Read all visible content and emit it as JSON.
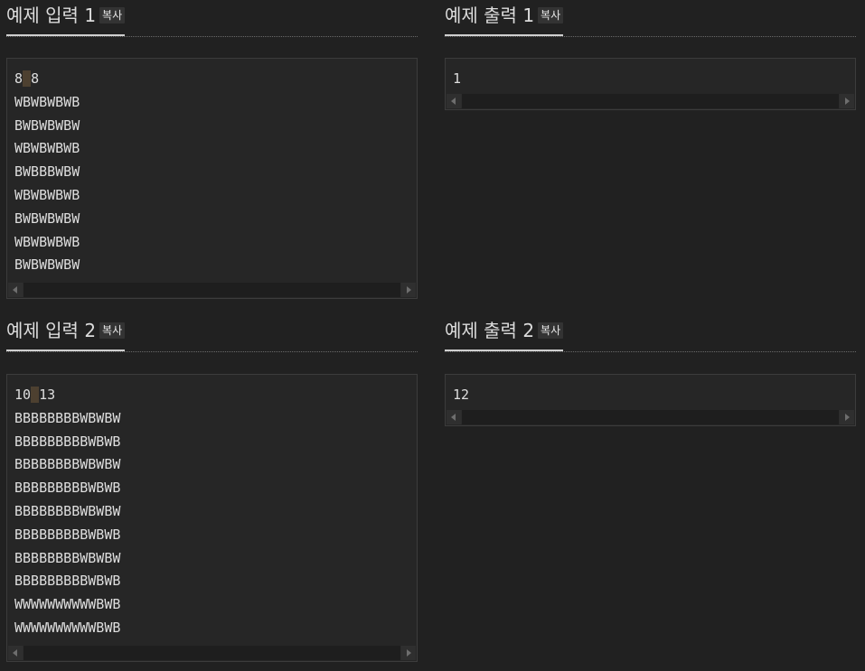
{
  "sections": [
    {
      "heading": "예제 입력 1",
      "copy_label": "복사",
      "first_line": [
        "8",
        " ",
        "8"
      ],
      "lines": "WBWBWBWB\nBWBWBWBW\nWBWBWBWB\nBWBBBWBW\nWBWBWBWB\nBWBWBWBW\nWBWBWBWB\nBWBWBWBW"
    },
    {
      "heading": "예제 출력 1",
      "copy_label": "복사",
      "first_line": [
        "1",
        "",
        ""
      ],
      "lines": ""
    },
    {
      "heading": "예제 입력 2",
      "copy_label": "복사",
      "first_line": [
        "10",
        " ",
        "13"
      ],
      "lines": "BBBBBBBBWBWBW\nBBBBBBBBBWBWB\nBBBBBBBBWBWBW\nBBBBBBBBBWBWB\nBBBBBBBBWBWBW\nBBBBBBBBBWBWB\nBBBBBBBBWBWBW\nBBBBBBBBBWBWB\nWWWWWWWWWWBWB\nWWWWWWWWWWBWB"
    },
    {
      "heading": "예제 출력 2",
      "copy_label": "복사",
      "first_line": [
        "12",
        "",
        ""
      ],
      "lines": ""
    }
  ],
  "colors": {
    "background": "#212121",
    "box": "#262626",
    "text": "#dedede",
    "highlight": "#4d4030"
  }
}
